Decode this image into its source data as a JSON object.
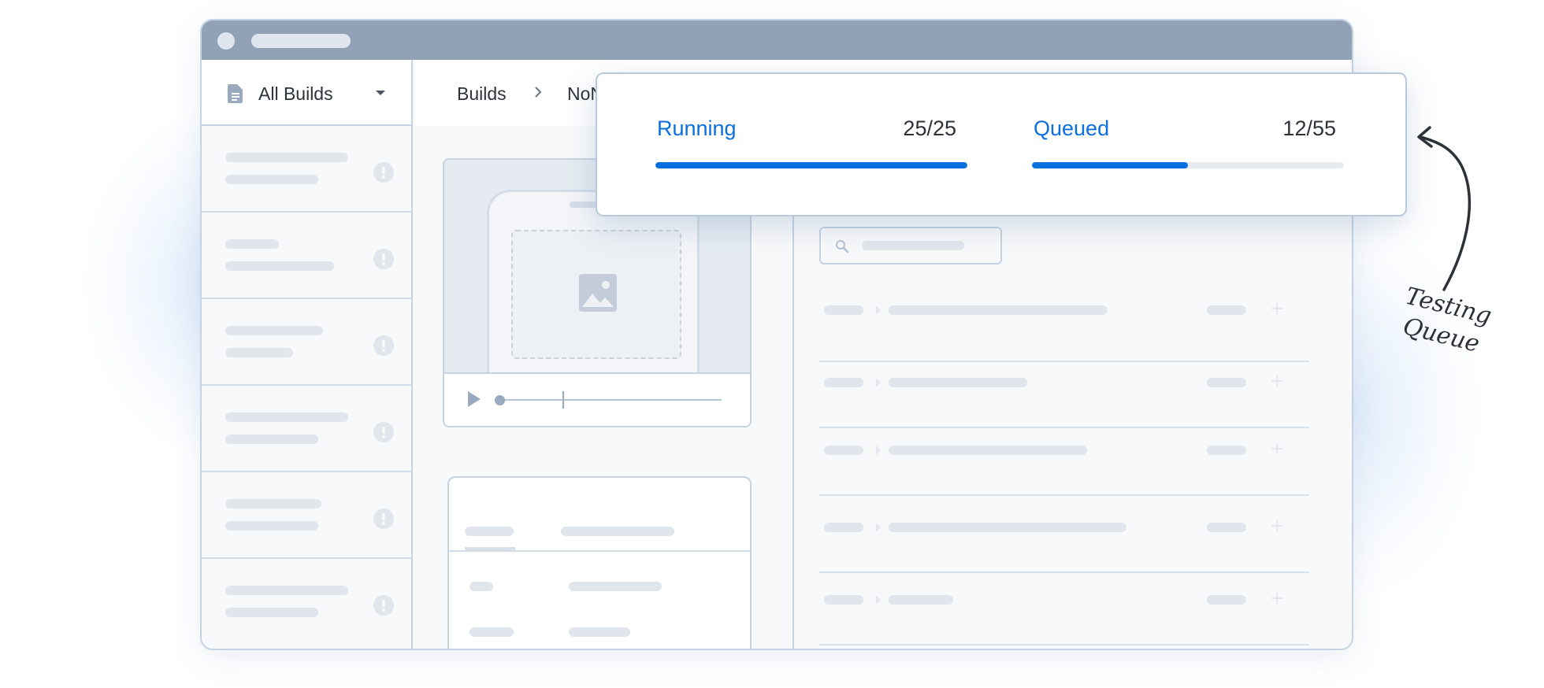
{
  "sidebar": {
    "title": "All Builds",
    "icon": "document-icon",
    "dropdown_icon": "caret-down-icon",
    "item_count": 6
  },
  "breadcrumb": {
    "items": [
      "Builds",
      "NoN"
    ],
    "separator_icon": "chevron-right-icon"
  },
  "queue_popover": {
    "running": {
      "label": "Running",
      "count": "25/25",
      "progress": 1.0
    },
    "queued": {
      "label": "Queued",
      "count": "12/55",
      "progress": 0.5
    }
  },
  "callout": {
    "line1": "Testing",
    "line2": "Queue"
  },
  "colors": {
    "accent": "#0c6fde",
    "titlebar": "#91a2b6",
    "border": "#c5d3e2"
  }
}
